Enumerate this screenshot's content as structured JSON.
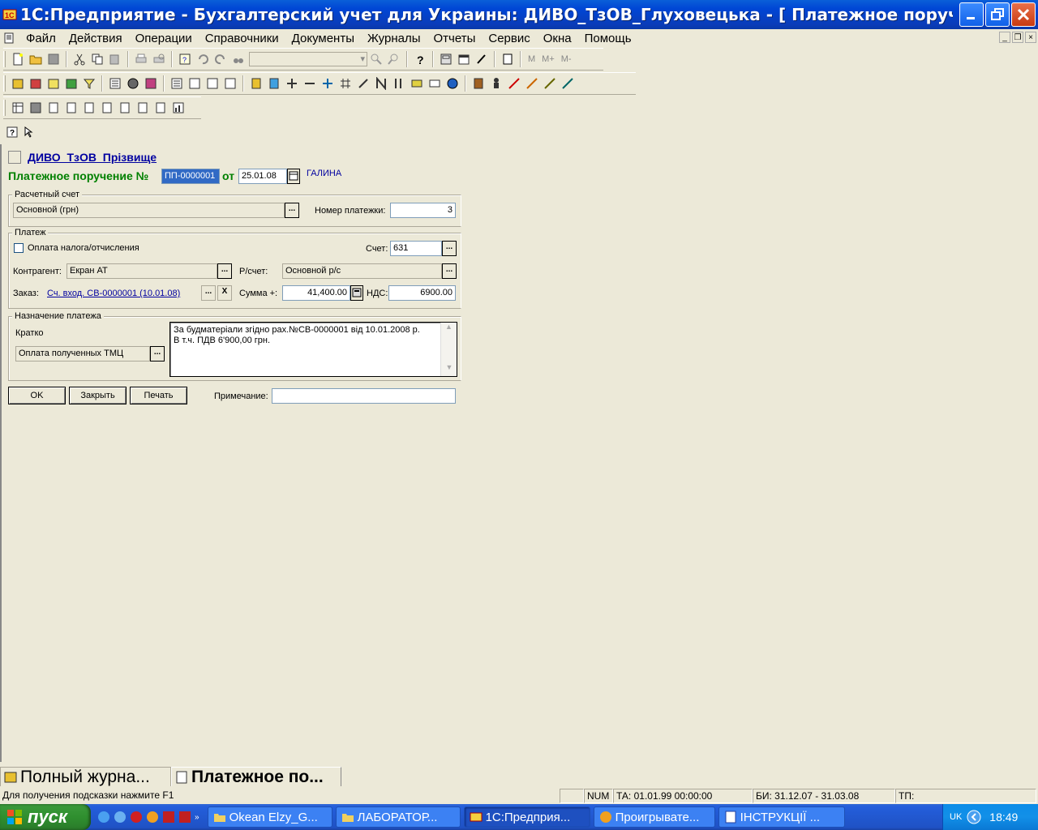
{
  "window": {
    "title": "1С:Предприятие - Бухгалтерский учет для Украины: ДИВО_ТзОВ_Глуховецька - [ Платежное поруче..."
  },
  "menu": [
    "Файл",
    "Действия",
    "Операции",
    "Справочники",
    "Документы",
    "Журналы",
    "Отчеты",
    "Сервис",
    "Окна",
    "Помощь"
  ],
  "toolbar": {
    "memory_labels": [
      "M",
      "M+",
      "M-"
    ]
  },
  "form": {
    "org_link": "ДИВО_ТзОВ_Прізвище",
    "doc_title_prefix": "Платежное поручение №",
    "doc_number": "ПП-0000001",
    "date_label": "от",
    "date_value": "25.01.08",
    "user_name": "ГАЛИНА",
    "account_group": {
      "title": "Расчетный счет",
      "account_value": "Основной (грн)",
      "payment_number_label": "Номер платежки:",
      "payment_number_value": "3"
    },
    "payment_group": {
      "title": "Платеж",
      "tax_checkbox_label": "Оплата налога/отчисления",
      "tax_checkbox_checked": false,
      "schet_label": "Счет:",
      "schet_value": "631",
      "counterparty_label": "Контрагент:",
      "counterparty_value": "Екран АТ",
      "rschet_label": "Р/счет:",
      "rschet_value": "Основной р/с",
      "order_label": "Заказ:",
      "order_link": "Сч. вход. СВ-0000001 (10.01.08)",
      "clear_label": "X",
      "sum_label": "Сумма +:",
      "sum_value": "41,400.00",
      "vat_label": "НДС:",
      "vat_value": "6900.00"
    },
    "purpose_group": {
      "title": "Назначение платежа",
      "short_label": "Кратко",
      "short_value": "Оплата полученных ТМЦ",
      "text_line1": "За будматеріали згідно рах.№СВ-0000001 від 10.01.2008 р.",
      "text_line2": "В т.ч. ПДВ 6'900,00 грн."
    },
    "buttons": {
      "ok": "OK",
      "close": "Закрыть",
      "print": "Печать"
    },
    "note_label": "Примечание:",
    "note_value": ""
  },
  "window_tabs": [
    "Полный журна...",
    "Платежное по..."
  ],
  "statusbar": {
    "hint": "Для получения подсказки нажмите F1",
    "num": "NUM",
    "ta": "ТА: 01.01.99  00:00:00",
    "bi": "БИ: 31.12.07 - 31.03.08",
    "tp": "ТП:"
  },
  "taskbar": {
    "start_label": "пуск",
    "tasks": [
      "Okean Elzy_G...",
      "ЛАБОРАТОР...",
      "1С:Предприя...",
      "Проигрывате...",
      "ІНСТРУКЦІЇ ..."
    ],
    "lang": "UK",
    "clock": "18:49"
  },
  "colors": {
    "title_bar": "#0046d5",
    "doc_title_green": "#008000",
    "link_blue": "#0000a0",
    "taskbar_blue": "#245edb",
    "start_green": "#2f8f2f"
  }
}
